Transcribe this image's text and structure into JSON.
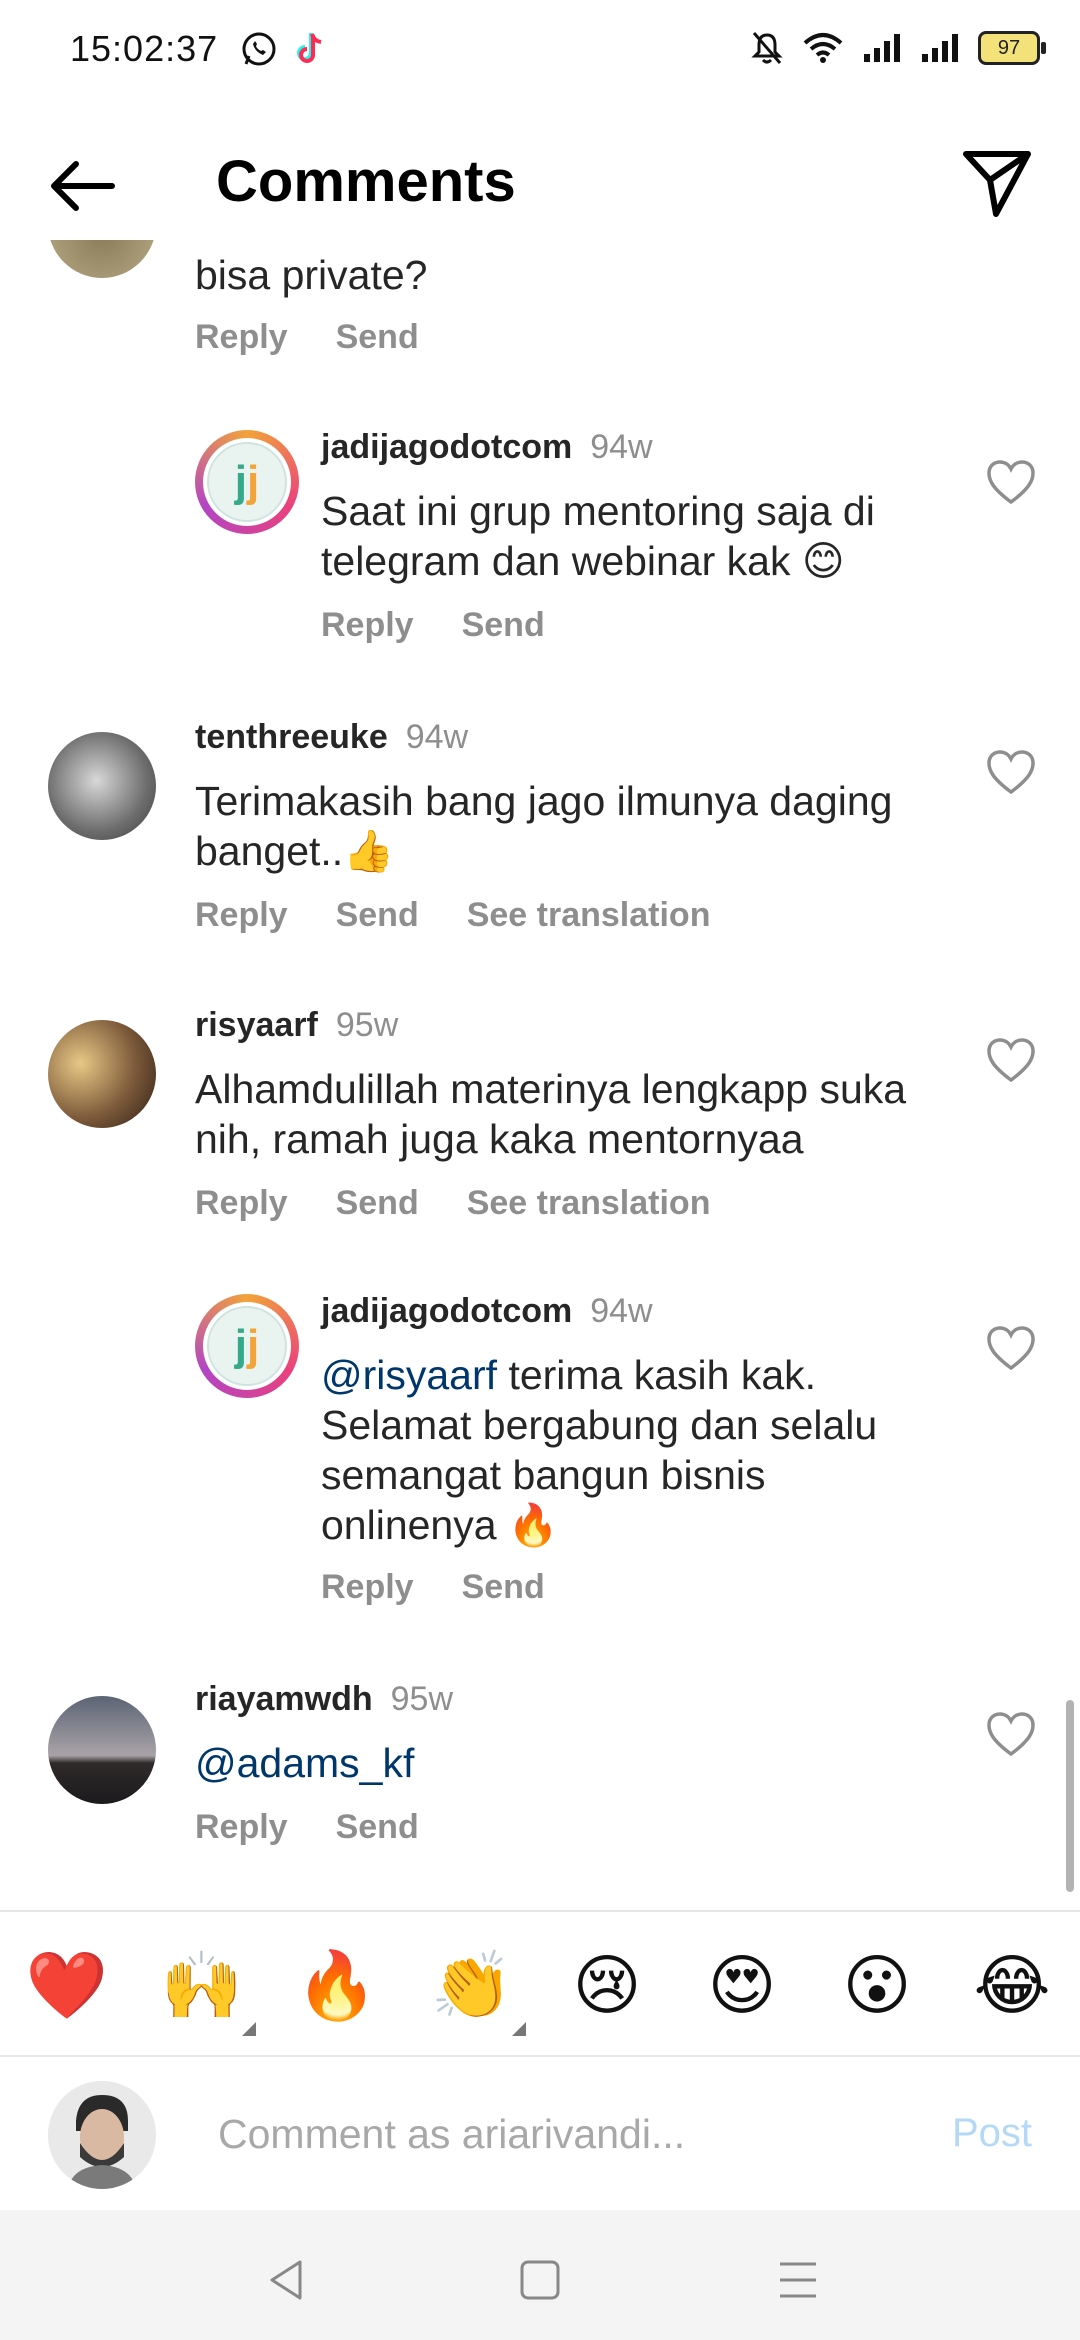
{
  "status_bar": {
    "time": "15:02:37",
    "battery": "97"
  },
  "header": {
    "title": "Comments"
  },
  "comments": [
    {
      "username": "",
      "time": "",
      "text": "bisa private?",
      "actions": [
        "Reply",
        "Send"
      ]
    },
    {
      "username": "jadijagodotcom",
      "time": "94w",
      "text": "Saat ini grup mentoring saja di telegram dan webinar kak 😊",
      "actions": [
        "Reply",
        "Send"
      ]
    },
    {
      "username": "tenthreeuke",
      "time": "94w",
      "text": "Terimakasih bang jago ilmunya daging banget..👍",
      "actions": [
        "Reply",
        "Send",
        "See translation"
      ]
    },
    {
      "username": "risyaarf",
      "time": "95w",
      "text": "Alhamdulillah materinya lengkapp suka nih, ramah juga kaka mentornyaa",
      "actions": [
        "Reply",
        "Send",
        "See translation"
      ]
    },
    {
      "username": "jadijagodotcom",
      "time": "94w",
      "mention": "@risyaarf",
      "text": " terima kasih kak. Selamat bergabung dan selalu semangat bangun bisnis onlinenya 🔥",
      "actions": [
        "Reply",
        "Send"
      ]
    },
    {
      "username": "riayamwdh",
      "time": "95w",
      "mention": "@adams_kf",
      "actions": [
        "Reply",
        "Send"
      ]
    }
  ],
  "emoji_reactions": [
    "❤️",
    "🙌",
    "🔥",
    "👏",
    "😢",
    "😍",
    "😮",
    "😂"
  ],
  "input": {
    "placeholder": "Comment as ariarivandi...",
    "post_label": "Post"
  },
  "colors": {
    "mention": "#00376b",
    "meta_gray": "#8e8e8e",
    "post_disabled": "#b3d9f6"
  },
  "icons": [
    "whatsapp-icon",
    "tiktok-icon",
    "mute-icon",
    "wifi-icon",
    "signal-icon",
    "battery-icon",
    "back-arrow-icon",
    "direct-send-icon",
    "heart-icon",
    "nav-back-icon",
    "nav-home-icon",
    "nav-menu-icon"
  ]
}
